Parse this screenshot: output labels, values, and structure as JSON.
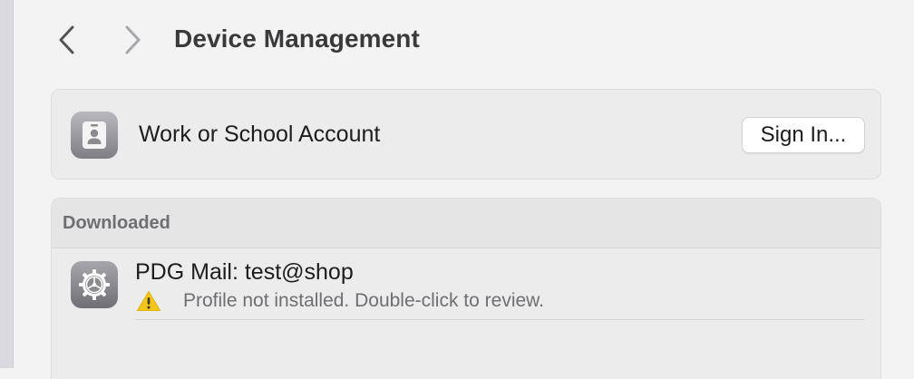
{
  "header": {
    "title": "Device Management",
    "back_icon": "chevron-left-icon",
    "forward_icon": "chevron-right-icon"
  },
  "account": {
    "label": "Work or School Account",
    "icon": "id-badge-icon",
    "sign_in_label": "Sign In..."
  },
  "downloaded": {
    "header": "Downloaded",
    "profiles": [
      {
        "name": "PDG Mail: test@shop",
        "icon": "gear-icon",
        "status_icon": "warning-icon",
        "status": "Profile not installed. Double-click to review."
      }
    ]
  },
  "colors": {
    "background": "#f3f3f3",
    "card": "#ececec",
    "warning": "#f5c518",
    "secondary_text": "#6e6e73"
  }
}
